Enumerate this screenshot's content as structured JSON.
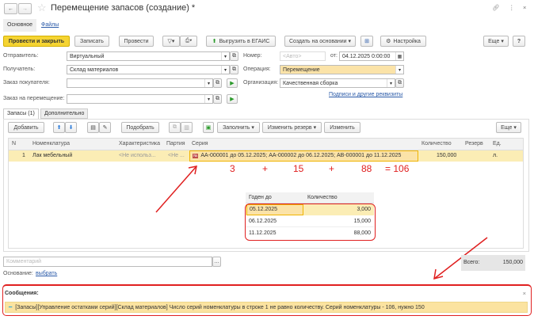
{
  "window": {
    "title": "Перемещение запасов (создание) *"
  },
  "tabs": [
    {
      "label": "Основное"
    },
    {
      "label": "Файлы"
    }
  ],
  "toolbar": {
    "post_close": "Провести и закрыть",
    "save": "Записать",
    "post": "Провести",
    "egais": "Выгрузить в ЕГАИС",
    "create_based": "Создать на основании",
    "settings": "Настройка",
    "more": "Еще",
    "help": "?"
  },
  "form": {
    "sender_label": "Отправитель:",
    "sender": "Виртуальный",
    "receiver_label": "Получатель:",
    "receiver": "Склад материалов",
    "customer_order_label": "Заказ покупателя:",
    "customer_order": "",
    "transfer_order_label": "Заказ на перемещение:",
    "transfer_order": "",
    "number_label": "Номер:",
    "number_placeholder": "<Авто>",
    "date_label": "от:",
    "date": "04.12.2025  0:00:00",
    "operation_label": "Операция:",
    "operation": "Перемещение",
    "org_label": "Организация:",
    "org": "Качественная сборка",
    "signatures_link": "Подписи и другие реквизиты"
  },
  "inner_tabs": [
    {
      "label": "Запасы (1)"
    },
    {
      "label": "Дополнительно"
    }
  ],
  "table_toolbar": {
    "add": "Добавить",
    "pick": "Подобрать",
    "fill": "Заполнить",
    "change_reserve": "Изменить резерв",
    "change": "Изменить",
    "more": "Еще"
  },
  "table": {
    "columns": [
      "N",
      "Номенклатура",
      "Характеристика",
      "Партия",
      "Серия",
      "Количество",
      "Резерв",
      "Ед."
    ],
    "rows": [
      {
        "n": "1",
        "item": "Лак мебельный",
        "char": "<Не использ...",
        "batch": "<Не ...",
        "series": "АА-000001 до 05.12.2025; АА-000002 до 06.12.2025; АВ-000001 до 11.12.2025",
        "qty": "150,000",
        "reserve": "",
        "unit": "л."
      }
    ]
  },
  "annotation": {
    "a": "3",
    "p1": "+",
    "b": "15",
    "p2": "+",
    "c": "88",
    "eq": "= 106"
  },
  "series_popup": {
    "columns": [
      "Годен до",
      "Количество"
    ],
    "rows": [
      {
        "date": "05.12.2025",
        "qty": "3,000"
      },
      {
        "date": "06.12.2025",
        "qty": "15,000"
      },
      {
        "date": "11.12.2025",
        "qty": "88,000"
      }
    ]
  },
  "footer": {
    "comment_placeholder": "Комментарий",
    "basis_label": "Основание:",
    "basis_link": "выбрать",
    "total_label": "Всего:",
    "total": "150,000"
  },
  "messages": {
    "title": "Сообщения:",
    "text": "[Запасы][Управление остатками серий][Склад материалов] Число серий номенклатуры в строке 1 не равно количеству. Серий номенклатуры - 106, нужно 150"
  },
  "colors": {
    "accent": "#f5d432",
    "highlight": "#fbedb5",
    "annotation": "#e02020"
  }
}
